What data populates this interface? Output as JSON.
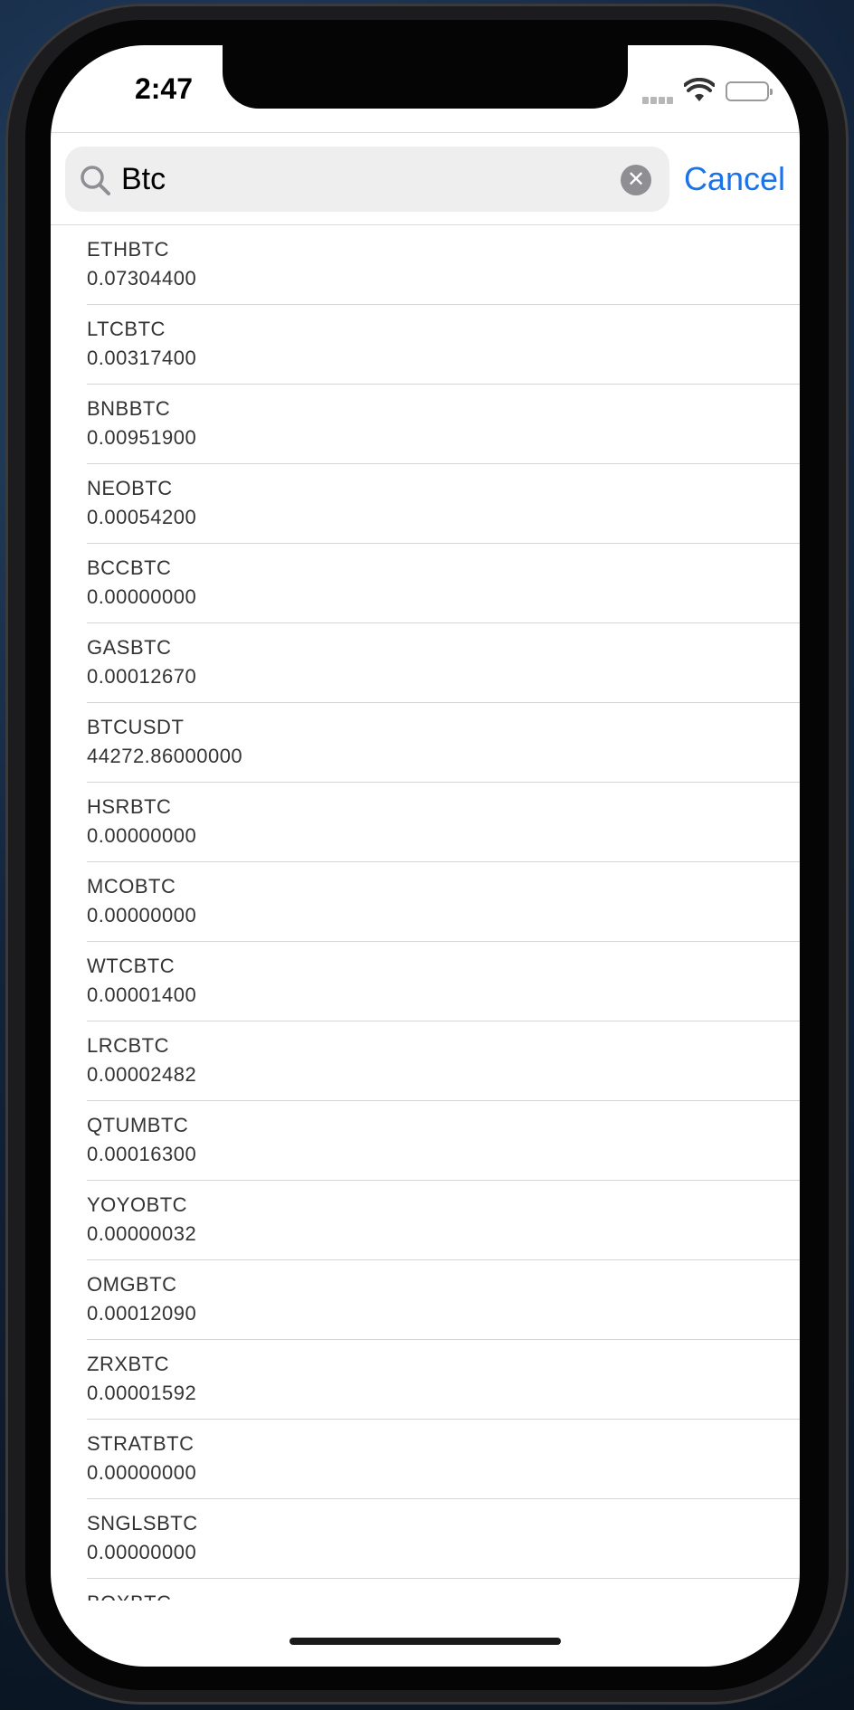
{
  "status_bar": {
    "time": "2:47"
  },
  "search": {
    "value": "Btc",
    "placeholder": "",
    "cancel_label": "Cancel",
    "clear_symbol": "✕"
  },
  "results": [
    {
      "symbol": "ETHBTC",
      "price": "0.07304400"
    },
    {
      "symbol": "LTCBTC",
      "price": "0.00317400"
    },
    {
      "symbol": "BNBBTC",
      "price": "0.00951900"
    },
    {
      "symbol": "NEOBTC",
      "price": "0.00054200"
    },
    {
      "symbol": "BCCBTC",
      "price": "0.00000000"
    },
    {
      "symbol": "GASBTC",
      "price": "0.00012670"
    },
    {
      "symbol": "BTCUSDT",
      "price": "44272.86000000"
    },
    {
      "symbol": "HSRBTC",
      "price": "0.00000000"
    },
    {
      "symbol": "MCOBTC",
      "price": "0.00000000"
    },
    {
      "symbol": "WTCBTC",
      "price": "0.00001400"
    },
    {
      "symbol": "LRCBTC",
      "price": "0.00002482"
    },
    {
      "symbol": "QTUMBTC",
      "price": "0.00016300"
    },
    {
      "symbol": "YOYOBTC",
      "price": "0.00000032"
    },
    {
      "symbol": "OMGBTC",
      "price": "0.00012090"
    },
    {
      "symbol": "ZRXBTC",
      "price": "0.00001592"
    },
    {
      "symbol": "STRATBTC",
      "price": "0.00000000"
    },
    {
      "symbol": "SNGLSBTC",
      "price": "0.00000000"
    },
    {
      "symbol": "BQXBTC",
      "price": ""
    }
  ],
  "colors": {
    "accent": "#1a73e8",
    "divider": "#d6d6d6",
    "search_bg": "#eeeeef"
  },
  "icons": {
    "search": "search-icon",
    "clear": "clear-icon",
    "wifi": "wifi-icon",
    "battery": "battery-icon",
    "signal": "signal-icon"
  }
}
